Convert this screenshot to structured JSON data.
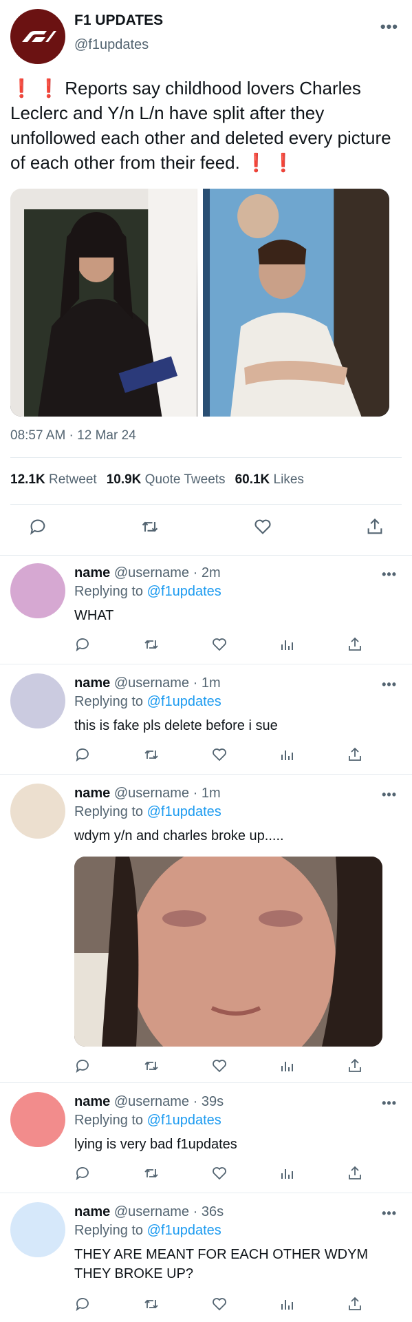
{
  "tweet": {
    "author_name": "F1 UPDATES",
    "author_handle": "@f1updates",
    "more_icon": "more-horizontal-icon",
    "text_start_marks": "❗ ❗",
    "text_body": "Reports say childhood lovers Charles Leclerc and Y/n L/n have split after they unfollowed each other and deleted every picture of each other from their feed.",
    "text_end_marks": "❗ ❗",
    "timestamp": "08:57 AM · 12 Mar 24",
    "stats": {
      "retweets_count": "12.1K",
      "retweets_label": "Retweet",
      "quotes_count": "10.9K",
      "quotes_label": "Quote Tweets",
      "likes_count": "60.1K",
      "likes_label": "Likes"
    },
    "accent_color": "#6b1212"
  },
  "replies": [
    {
      "name": "name",
      "meta": "@username · 2m",
      "replying_label": "Replying to",
      "replying_to": "@f1updates",
      "text": "WHAT",
      "avatar_color": "#d6a8d2"
    },
    {
      "name": "name",
      "meta": "@username · 1m",
      "replying_label": "Replying to",
      "replying_to": "@f1updates",
      "text": "this is fake pls delete before i sue",
      "avatar_color": "#cbcbe0"
    },
    {
      "name": "name",
      "meta": "@username · 1m",
      "replying_label": "Replying to",
      "replying_to": "@f1updates",
      "text": "wdym y/n and charles broke up.....",
      "avatar_color": "#ecdfcf"
    },
    {
      "name": "name",
      "meta": "@username · 39s",
      "replying_label": "Replying to",
      "replying_to": "@f1updates",
      "text": "lying is very bad f1updates",
      "avatar_color": "#f28c8c"
    },
    {
      "name": "name",
      "meta": "@username · 36s",
      "replying_label": "Replying to",
      "replying_to": "@f1updates",
      "text": "THEY ARE MEANT FOR EACH OTHER WDYM THEY BROKE UP?",
      "avatar_color": "#d6e8fa"
    }
  ],
  "colors": {
    "link": "#1d9bf0",
    "secondary_text": "#536471",
    "divider": "#e6ecf0"
  }
}
